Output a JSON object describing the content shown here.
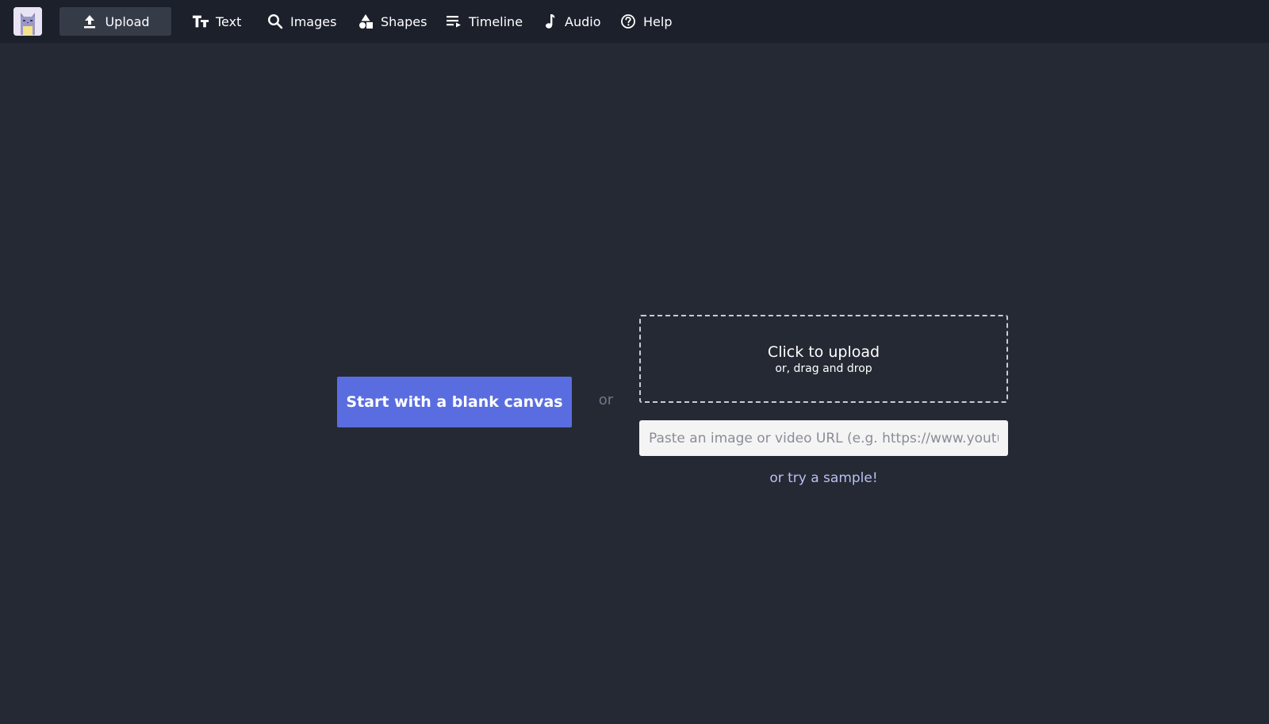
{
  "nav": {
    "items": [
      {
        "label": "Upload",
        "icon": "upload-icon",
        "active": true
      },
      {
        "label": "Text",
        "icon": "text-size-icon"
      },
      {
        "label": "Images",
        "icon": "search-icon"
      },
      {
        "label": "Shapes",
        "icon": "shapes-icon"
      },
      {
        "label": "Timeline",
        "icon": "timeline-icon"
      },
      {
        "label": "Audio",
        "icon": "music-note-icon"
      },
      {
        "label": "Help",
        "icon": "help-circle-icon"
      }
    ]
  },
  "main": {
    "blank_button": "Start with a blank canvas",
    "or_text": "or",
    "dropzone": {
      "title": "Click to upload",
      "subtitle": "or, drag and drop"
    },
    "url_input": {
      "placeholder": "Paste an image or video URL (e.g. https://www.youtube.com/watch?v=...)",
      "value": ""
    },
    "sample_link": "or try a sample!"
  },
  "colors": {
    "background": "#252934",
    "topbar": "#1c202b",
    "active_tab": "#363b48",
    "primary_button": "#5a6de0",
    "link": "#b9c0ef"
  }
}
